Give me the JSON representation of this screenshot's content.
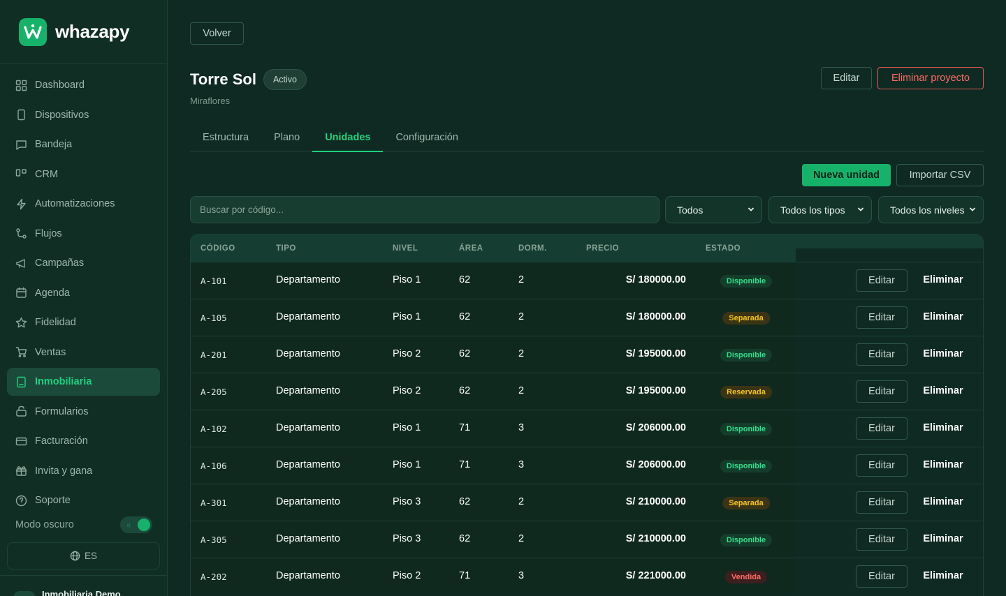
{
  "brand": {
    "name": "whazapy"
  },
  "colors": {
    "accent": "#1fd17f",
    "brand": "#17b26a",
    "danger": "#ff6b66",
    "background": "#0f2a22"
  },
  "sidebar": {
    "items": [
      {
        "label": "Dashboard",
        "icon": "grid-icon"
      },
      {
        "label": "Dispositivos",
        "icon": "phone-icon"
      },
      {
        "label": "Bandeja",
        "icon": "chat-icon"
      },
      {
        "label": "CRM",
        "icon": "kanban-icon"
      },
      {
        "label": "Automatizaciones",
        "icon": "bolt-icon"
      },
      {
        "label": "Flujos",
        "icon": "flow-icon"
      },
      {
        "label": "Campañas",
        "icon": "megaphone-icon"
      },
      {
        "label": "Agenda",
        "icon": "calendar-icon"
      },
      {
        "label": "Fidelidad",
        "icon": "star-icon"
      },
      {
        "label": "Ventas",
        "icon": "cart-icon"
      },
      {
        "label": "Inmobiliaria",
        "icon": "building-icon",
        "active": true
      },
      {
        "label": "Formularios",
        "icon": "form-icon"
      },
      {
        "label": "Facturación",
        "icon": "card-icon"
      },
      {
        "label": "Invita y gana",
        "icon": "gift-icon"
      },
      {
        "label": "Soporte",
        "icon": "help-icon"
      }
    ],
    "dark_mode_label": "Modo oscuro",
    "dark_mode_on": true,
    "language": "ES",
    "account_name": "Inmobiliaria Demo"
  },
  "header": {
    "back_label": "Volver",
    "title": "Torre Sol",
    "status": "Activo",
    "subtitle": "Miraflores",
    "edit_label": "Editar",
    "delete_label": "Eliminar proyecto"
  },
  "tabs": [
    {
      "label": "Estructura"
    },
    {
      "label": "Plano"
    },
    {
      "label": "Unidades",
      "active": true
    },
    {
      "label": "Configuración"
    }
  ],
  "actions": {
    "new_unit": "Nueva unidad",
    "import_csv": "Importar CSV"
  },
  "filters": {
    "search_placeholder": "Buscar por código...",
    "status": "Todos",
    "type": "Todos los tipos",
    "level": "Todos los niveles"
  },
  "table": {
    "columns": [
      "CÓDIGO",
      "TIPO",
      "NIVEL",
      "ÁREA",
      "DORM.",
      "PRECIO",
      "ESTADO"
    ],
    "edit_label": "Editar",
    "delete_label": "Eliminar",
    "rows": [
      {
        "code": "A-101",
        "type": "Departamento",
        "level": "Piso 1",
        "area": "62",
        "beds": "2",
        "price": "S/ 180000.00",
        "status": "Disponible"
      },
      {
        "code": "A-105",
        "type": "Departamento",
        "level": "Piso 1",
        "area": "62",
        "beds": "2",
        "price": "S/ 180000.00",
        "status": "Separada"
      },
      {
        "code": "A-201",
        "type": "Departamento",
        "level": "Piso 2",
        "area": "62",
        "beds": "2",
        "price": "S/ 195000.00",
        "status": "Disponible"
      },
      {
        "code": "A-205",
        "type": "Departamento",
        "level": "Piso 2",
        "area": "62",
        "beds": "2",
        "price": "S/ 195000.00",
        "status": "Reservada"
      },
      {
        "code": "A-102",
        "type": "Departamento",
        "level": "Piso 1",
        "area": "71",
        "beds": "3",
        "price": "S/ 206000.00",
        "status": "Disponible"
      },
      {
        "code": "A-106",
        "type": "Departamento",
        "level": "Piso 1",
        "area": "71",
        "beds": "3",
        "price": "S/ 206000.00",
        "status": "Disponible"
      },
      {
        "code": "A-301",
        "type": "Departamento",
        "level": "Piso 3",
        "area": "62",
        "beds": "2",
        "price": "S/ 210000.00",
        "status": "Separada"
      },
      {
        "code": "A-305",
        "type": "Departamento",
        "level": "Piso 3",
        "area": "62",
        "beds": "2",
        "price": "S/ 210000.00",
        "status": "Disponible"
      },
      {
        "code": "A-202",
        "type": "Departamento",
        "level": "Piso 2",
        "area": "71",
        "beds": "3",
        "price": "S/ 221000.00",
        "status": "Vendida"
      }
    ]
  },
  "status_styles": {
    "Disponible": {
      "bg": "#153d2b",
      "fg": "#2ee08a"
    },
    "Separada": {
      "bg": "#3a3414",
      "fg": "#f5c518"
    },
    "Reservada": {
      "bg": "#3a3414",
      "fg": "#f5c518"
    },
    "Vendida": {
      "bg": "#3d1f1f",
      "fg": "#ff6b66"
    }
  }
}
